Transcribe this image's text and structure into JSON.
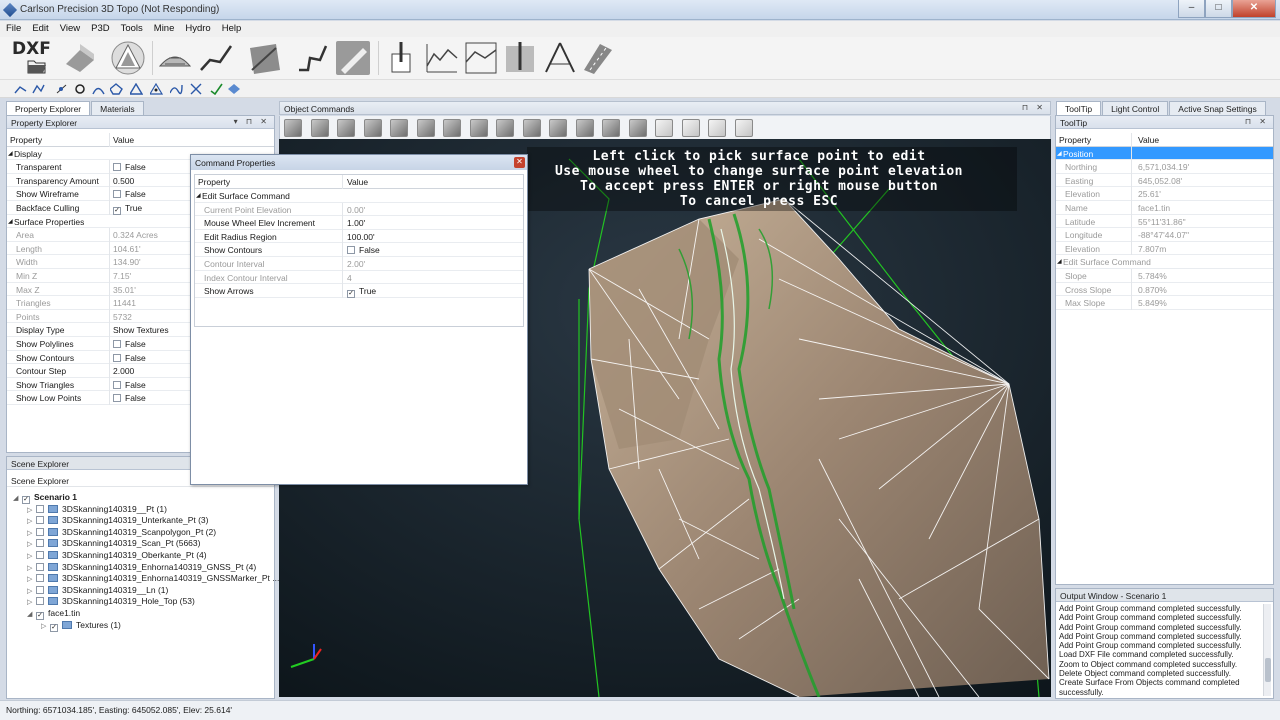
{
  "window": {
    "title": "Carlson Precision 3D Topo (Not Responding)",
    "min": "–",
    "max": "□",
    "close": "✕"
  },
  "menu": [
    "File",
    "Edit",
    "View",
    "P3D",
    "Tools",
    "Mine",
    "Hydro",
    "Help"
  ],
  "toolbar": {
    "dxf_label": "DXF"
  },
  "left_tabs": [
    "Property Explorer",
    "Materials"
  ],
  "property_explorer": {
    "title": "Property Explorer",
    "col_property": "Property",
    "col_value": "Value",
    "rows": [
      {
        "name": "Display",
        "value": "",
        "kind": "cat"
      },
      {
        "name": "Transparent",
        "value": "False",
        "kind": "check"
      },
      {
        "name": "Transparency Amount",
        "value": "0.500",
        "kind": "text"
      },
      {
        "name": "Show Wireframe",
        "value": "False",
        "kind": "check"
      },
      {
        "name": "Backface Culling",
        "value": "True",
        "kind": "checked"
      },
      {
        "name": "Surface Properties",
        "value": "",
        "kind": "cat"
      },
      {
        "name": "Area",
        "value": "0.324 Acres",
        "kind": "dim"
      },
      {
        "name": "Length",
        "value": "104.61'",
        "kind": "dim"
      },
      {
        "name": "Width",
        "value": "134.90'",
        "kind": "dim"
      },
      {
        "name": "Min Z",
        "value": "7.15'",
        "kind": "dim"
      },
      {
        "name": "Max Z",
        "value": "35.01'",
        "kind": "dim"
      },
      {
        "name": "Triangles",
        "value": "11441",
        "kind": "dim"
      },
      {
        "name": "Points",
        "value": "5732",
        "kind": "dim"
      },
      {
        "name": "Display Type",
        "value": "Show Textures",
        "kind": "text"
      },
      {
        "name": "Show Polylines",
        "value": "False",
        "kind": "check"
      },
      {
        "name": "Show Contours",
        "value": "False",
        "kind": "check"
      },
      {
        "name": "Contour Step",
        "value": "2.000",
        "kind": "text"
      },
      {
        "name": "Show Triangles",
        "value": "False",
        "kind": "check"
      },
      {
        "name": "Show Low Points",
        "value": "False",
        "kind": "check"
      }
    ]
  },
  "scene_explorer": {
    "panel_title": "Scene Explorer",
    "inner_title": "Scene Explorer",
    "items": [
      {
        "label": "Scenario 1",
        "level": 0,
        "checked": true,
        "bold": true
      },
      {
        "label": "3DSkanning140319__Pt (1)",
        "level": 1,
        "checked": false
      },
      {
        "label": "3DSkanning140319_Unterkante_Pt (3)",
        "level": 1,
        "checked": false
      },
      {
        "label": "3DSkanning140319_Scanpolygon_Pt (2)",
        "level": 1,
        "checked": false
      },
      {
        "label": "3DSkanning140319_Scan_Pt (5663)",
        "level": 1,
        "checked": false
      },
      {
        "label": "3DSkanning140319_Oberkante_Pt (4)",
        "level": 1,
        "checked": false
      },
      {
        "label": "3DSkanning140319_Enhorna140319_GNSS_Pt (4)",
        "level": 1,
        "checked": false
      },
      {
        "label": "3DSkanning140319_Enhorna140319_GNSSMarker_Pt ...",
        "level": 1,
        "checked": false
      },
      {
        "label": "3DSkanning140319__Ln (1)",
        "level": 1,
        "checked": false
      },
      {
        "label": "3DSkanning140319_Hole_Top (53)",
        "level": 1,
        "checked": false
      },
      {
        "label": "face1.tin",
        "level": 1,
        "checked": true,
        "plain": true
      },
      {
        "label": "Textures (1)",
        "level": 2,
        "checked": true
      }
    ]
  },
  "object_commands": {
    "title": "Object Commands"
  },
  "viewport": {
    "lines": [
      "Left click to pick surface point to edit",
      "Use mouse wheel to change surface point elevation",
      "To accept press ENTER or right mouse button",
      "To cancel press ESC"
    ]
  },
  "command_properties": {
    "title": "Command Properties",
    "close": "✕",
    "col_property": "Property",
    "col_value": "Value",
    "rows": [
      {
        "name": "Edit Surface Command",
        "value": "",
        "kind": "cat"
      },
      {
        "name": "Current Point Elevation",
        "value": "0.00'",
        "kind": "dim"
      },
      {
        "name": "Mouse Wheel Elev Increment",
        "value": "1.00'",
        "kind": "text"
      },
      {
        "name": "Edit Radius Region",
        "value": "100.00'",
        "kind": "text"
      },
      {
        "name": "Show Contours",
        "value": "False",
        "kind": "check"
      },
      {
        "name": "Contour Interval",
        "value": "2.00'",
        "kind": "dim"
      },
      {
        "name": "Index Contour Interval",
        "value": "4",
        "kind": "dim"
      },
      {
        "name": "Show Arrows",
        "value": "True",
        "kind": "checked"
      }
    ]
  },
  "right_tabs": [
    "ToolTip",
    "Light Control",
    "Active Snap Settings"
  ],
  "tooltip": {
    "title": "ToolTip",
    "col_property": "Property",
    "col_value": "Value",
    "rows": [
      {
        "name": "Position",
        "value": "",
        "kind": "sel"
      },
      {
        "name": "Northing",
        "value": "6,571,034.19'",
        "kind": "dim"
      },
      {
        "name": "Easting",
        "value": "645,052.08'",
        "kind": "dim"
      },
      {
        "name": "Elevation",
        "value": "25.61'",
        "kind": "dim"
      },
      {
        "name": "Name",
        "value": "face1.tin",
        "kind": "dim"
      },
      {
        "name": "Latitude",
        "value": "55°11'31.86\"",
        "kind": "dim"
      },
      {
        "name": "Longitude",
        "value": "-88°47'44.07\"",
        "kind": "dim"
      },
      {
        "name": "Elevation",
        "value": "7.807m",
        "kind": "dim"
      },
      {
        "name": "Edit Surface Command",
        "value": "",
        "kind": "catdim"
      },
      {
        "name": "Slope",
        "value": "5.784%",
        "kind": "dim"
      },
      {
        "name": "Cross Slope",
        "value": "0.870%",
        "kind": "dim"
      },
      {
        "name": "Max Slope",
        "value": "5.849%",
        "kind": "dim"
      }
    ]
  },
  "output": {
    "title": "Output Window - Scenario 1",
    "lines": [
      "Add Point Group command completed successfully.",
      "Add Point Group command completed successfully.",
      "Add Point Group command completed successfully.",
      "Add Point Group command completed successfully.",
      "Add Point Group command completed successfully.",
      "Load DXF File command completed successfully.",
      "Zoom to Object command completed successfully.",
      "Delete Object command completed successfully.",
      "Create Surface From Objects command completed",
      "successfully."
    ]
  },
  "status": {
    "text": "Northing: 6571034.185', Easting: 645052.085', Elev: 25.614'"
  }
}
